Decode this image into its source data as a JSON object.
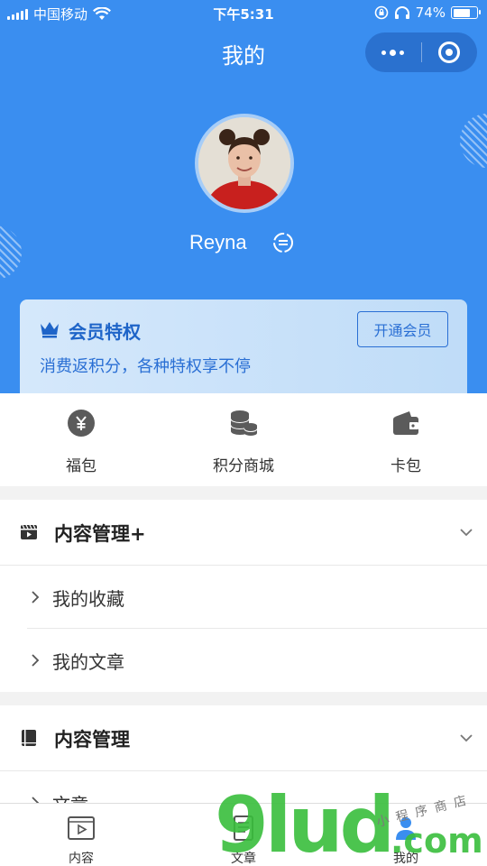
{
  "status_bar": {
    "carrier": "中国移动",
    "time": "下午5:31",
    "battery_text": "74%",
    "battery_level": 0.74
  },
  "nav": {
    "title": "我的",
    "more_icon": "ellipsis-icon",
    "close_icon": "target-icon"
  },
  "profile": {
    "name": "Reyna"
  },
  "member": {
    "title": "会员特权",
    "subtitle": "消费返积分，各种特权享不停",
    "button": "开通会员"
  },
  "quick_actions": [
    {
      "label": "福包",
      "icon": "yen-coin-icon"
    },
    {
      "label": "积分商城",
      "icon": "coin-stack-icon"
    },
    {
      "label": "卡包",
      "icon": "wallet-icon"
    }
  ],
  "sections": [
    {
      "title": "内容管理+",
      "icon": "video-clapper-icon",
      "items": [
        "我的收藏",
        "我的文章"
      ]
    },
    {
      "title": "内容管理",
      "icon": "book-icon",
      "items": [
        "文章"
      ]
    }
  ],
  "tabbar": [
    {
      "label": "内容",
      "icon": "video-play-icon"
    },
    {
      "label": "文章",
      "icon": "document-icon"
    },
    {
      "label": "我的",
      "icon": "user-icon"
    }
  ],
  "watermark": {
    "brand": "9lud",
    "suffix": ".com",
    "small_text": "小程序商店"
  },
  "colors": {
    "primary": "#3a8ef0",
    "member_text": "#1e64c8",
    "watermark_green": "#38be3c"
  }
}
